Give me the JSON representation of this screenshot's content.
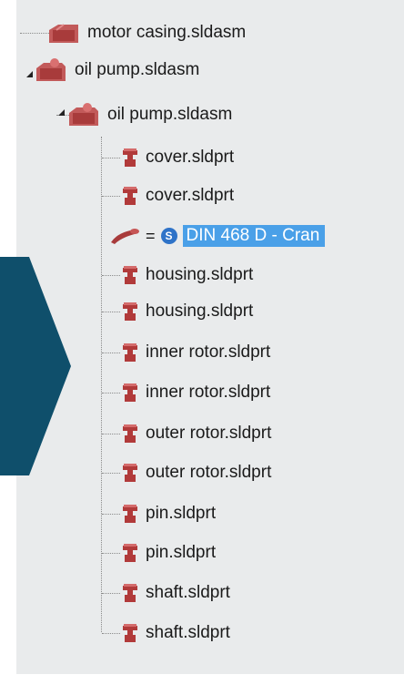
{
  "tree": {
    "assemblies": [
      {
        "label": "motor casing.sldasm",
        "expanded": false
      },
      {
        "label": "oil pump.sldasm",
        "expanded": true
      },
      {
        "label": "oil pump.sldasm",
        "expanded": true
      }
    ],
    "parts": [
      "cover.sldprt",
      "cover.sldprt",
      "housing.sldprt",
      "housing.sldprt",
      "inner rotor.sldprt",
      "inner rotor.sldprt",
      "outer rotor.sldprt",
      "outer rotor.sldprt",
      "pin.sldprt",
      "pin.sldprt",
      "shaft.sldprt",
      "shaft.sldprt"
    ],
    "selected_item": {
      "prefix": "=",
      "badge": "S",
      "label": "DIN 468 D - Cran"
    }
  },
  "colors": {
    "panel_bg": "#e9ebec",
    "selection": "#4aa0e8",
    "arrow": "#0f4f6b",
    "part_icon": "#b13a3a",
    "assembly_icon": "#c25a5a"
  }
}
